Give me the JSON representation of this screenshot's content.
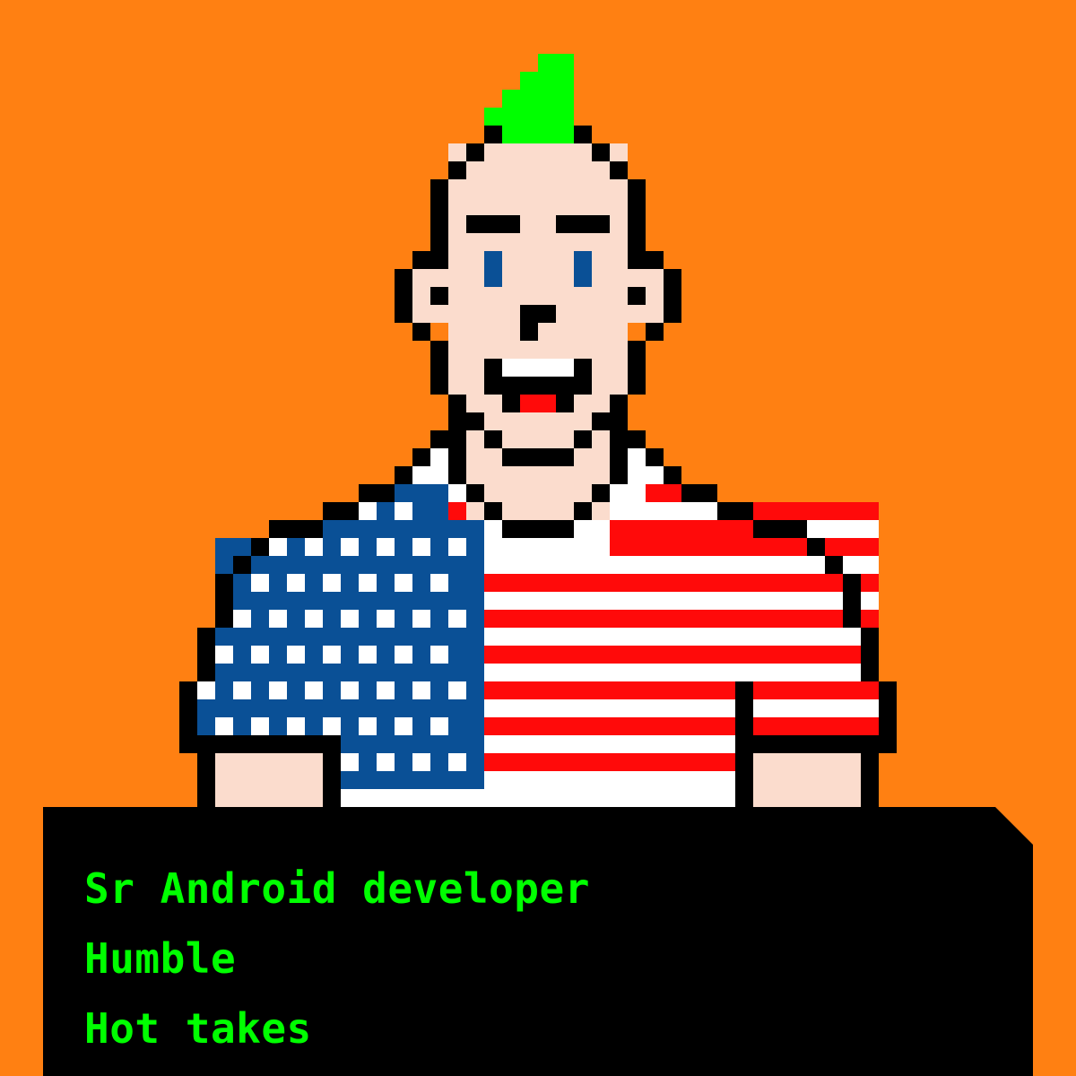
{
  "colors": {
    "background": "#FF8012",
    "text": "#00FF00",
    "panel": "#000000",
    "skin": "#FBDCCD",
    "hair": "#00FF00",
    "eyes": "#0A5096",
    "flag_blue": "#0A5096",
    "flag_red": "#FF0A0A",
    "flag_white": "#FFFFFF",
    "tongue": "#FF0A0A"
  },
  "avatar": {
    "label": "pixel-art punk with green mohawk wearing American flag shirt",
    "icon": "pixel-avatar-icon"
  },
  "caption": {
    "lines": [
      "Sr Android developer",
      "Humble",
      "Hot takes"
    ]
  }
}
